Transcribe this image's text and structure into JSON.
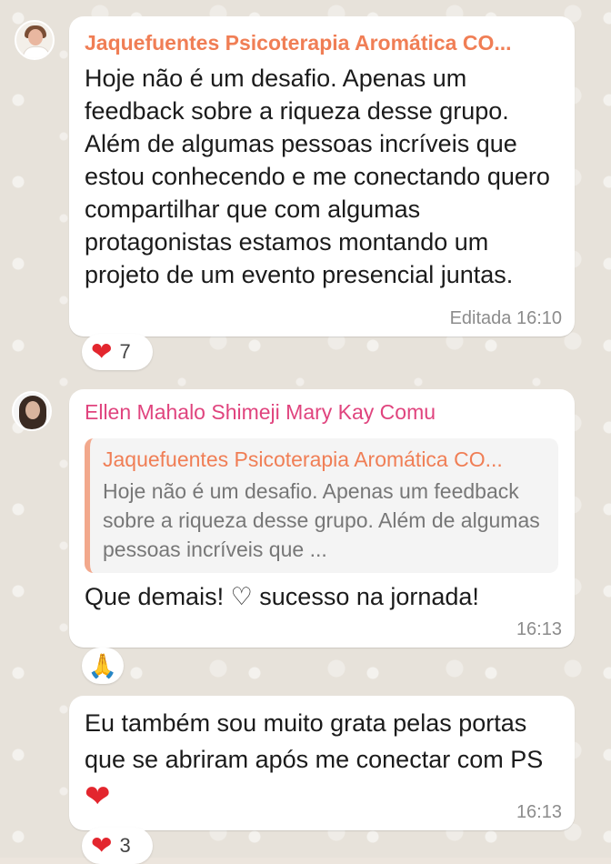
{
  "messages": [
    {
      "sender": "Jaquefuentes Psicoterapia Aromática CO...",
      "text": "Hoje não é  um desafio. Apenas um feedback  sobre a riqueza desse grupo. Além  de algumas pessoas incríveis  que estou conhecendo e me conectando  quero compartilhar  que com algumas protagonistas  estamos montando um projeto de um evento presencial juntas.",
      "meta": "Editada 16:10",
      "reaction": {
        "emoji": "❤",
        "count": "7"
      }
    },
    {
      "sender": "Ellen Mahalo Shimeji Mary Kay Comu",
      "quote_sender": "Jaquefuentes Psicoterapia Aromática CO...",
      "quote_text": "Hoje não é  um desafio. Apenas um feedback  sobre a riqueza desse grupo. Além  de algumas pessoas incríveis  que ...",
      "text": "Que demais! ♡ sucesso na jornada!",
      "meta": "16:13",
      "reaction": {
        "emoji": "🙏"
      }
    },
    {
      "text": "Eu também sou muito grata pelas portas que se abriram após me conectar com PS",
      "meta": "16:13",
      "reaction": {
        "emoji": "❤",
        "count": "3"
      }
    }
  ],
  "colors": {
    "sender1": "#f07e55",
    "sender2": "#e0447e",
    "heart": "#e3262e"
  }
}
